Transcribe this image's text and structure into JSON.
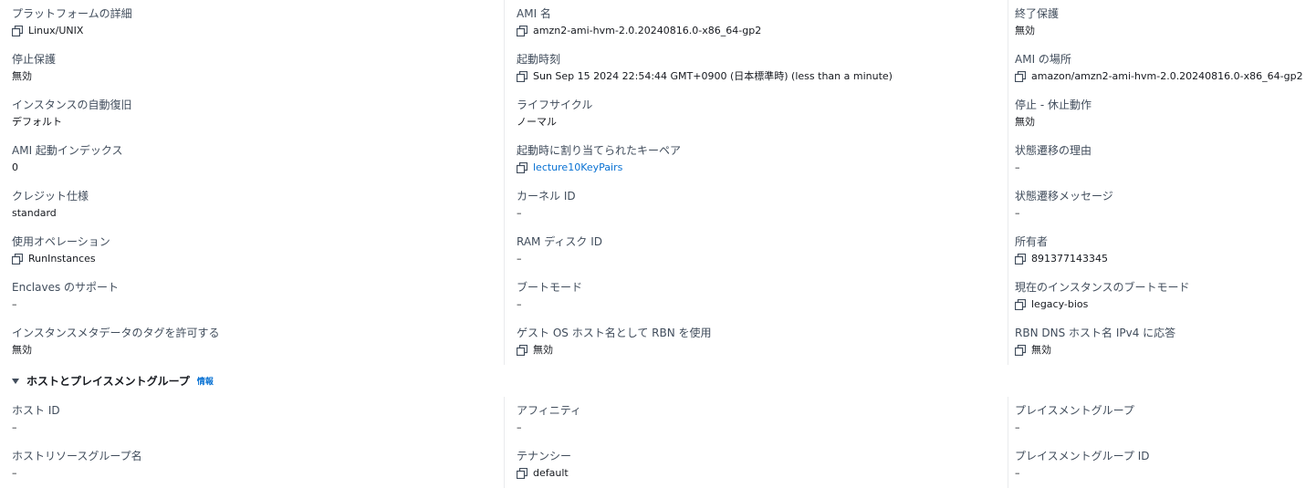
{
  "details": {
    "col1": [
      {
        "label": "プラットフォームの詳細",
        "value": "Linux/UNIX"
      },
      {
        "label": "停止保護",
        "value": "無効"
      },
      {
        "label": "インスタンスの自動復旧",
        "value": "デフォルト"
      },
      {
        "label": "AMI 起動インデックス",
        "value": "0"
      },
      {
        "label": "クレジット仕様",
        "value": "standard"
      },
      {
        "label": "使用オペレーション",
        "value": "RunInstances"
      },
      {
        "label": "Enclaves のサポート",
        "value": "–"
      },
      {
        "label": "インスタンスメタデータのタグを許可する",
        "value": "無効"
      }
    ],
    "col2": [
      {
        "label": "AMI 名",
        "value": "amzn2-ami-hvm-2.0.20240816.0-x86_64-gp2"
      },
      {
        "label": "起動時刻",
        "value": "Sun Sep 15 2024 22:54:44 GMT+0900 (日本標準時) (less than a minute)"
      },
      {
        "label": "ライフサイクル",
        "value": "ノーマル"
      },
      {
        "label": "起動時に割り当てられたキーペア",
        "value": "lecture10KeyPairs"
      },
      {
        "label": "カーネル ID",
        "value": "–"
      },
      {
        "label": "RAM ディスク ID",
        "value": "–"
      },
      {
        "label": "ブートモード",
        "value": "–"
      },
      {
        "label": "ゲスト OS ホスト名として RBN を使用",
        "value": "無効"
      }
    ],
    "col3": [
      {
        "label": "終了保護",
        "value": "無効"
      },
      {
        "label": "AMI の場所",
        "value": "amazon/amzn2-ami-hvm-2.0.20240816.0-x86_64-gp2"
      },
      {
        "label": "停止 - 休止動作",
        "value": "無効"
      },
      {
        "label": "状態遷移の理由",
        "value": "–"
      },
      {
        "label": "状態遷移メッセージ",
        "value": "–"
      },
      {
        "label": "所有者",
        "value": "891377143345"
      },
      {
        "label": "現在のインスタンスのブートモード",
        "value": "legacy-bios"
      },
      {
        "label": "RBN DNS ホスト名 IPv4 に応答",
        "value": "無効"
      }
    ]
  },
  "section": {
    "title": "ホストとプレイスメントグループ",
    "info_label": "情報"
  },
  "host": {
    "col1": [
      {
        "label": "ホスト ID",
        "value": "–"
      },
      {
        "label": "ホストリソースグループ名",
        "value": "–"
      }
    ],
    "col2": [
      {
        "label": "アフィニティ",
        "value": "–"
      },
      {
        "label": "テナンシー",
        "value": "default"
      }
    ],
    "col3": [
      {
        "label": "プレイスメントグループ",
        "value": "–"
      },
      {
        "label": "プレイスメントグループ ID",
        "value": "–"
      }
    ]
  },
  "colors": {
    "label": "#414d5c",
    "value": "#16191f",
    "link": "#0972d3",
    "divider": "#e9ebed"
  }
}
